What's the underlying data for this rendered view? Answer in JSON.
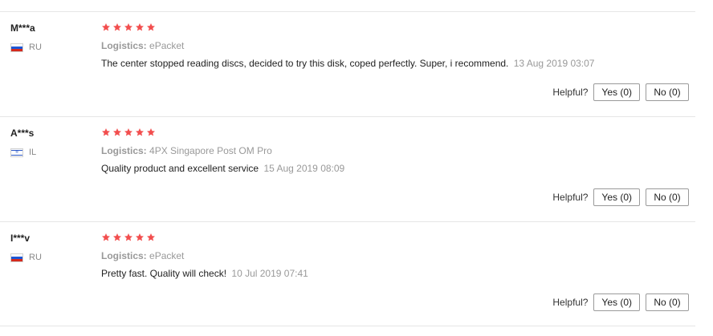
{
  "colors": {
    "star": "#f24e4e",
    "muted_text": "#999999",
    "separator": "#e6e6e6"
  },
  "helpful_label": "Helpful?",
  "reviews": [
    {
      "user": "M***a",
      "country": "RU",
      "flag_icon": "russia-flag-icon",
      "rating": 5,
      "logistics_label": "Logistics:",
      "logistics_value": "ePacket",
      "text": "The center stopped reading discs, decided to try this disk, coped perfectly. Super, i recommend.",
      "date": "13 Aug 2019 03:07",
      "yes_label": "Yes (0)",
      "no_label": "No (0)"
    },
    {
      "user": "A***s",
      "country": "IL",
      "flag_icon": "israel-flag-icon",
      "rating": 5,
      "logistics_label": "Logistics:",
      "logistics_value": "4PX Singapore Post OM Pro",
      "text": "Quality product and excellent service",
      "date": "15 Aug 2019 08:09",
      "yes_label": "Yes (0)",
      "no_label": "No (0)"
    },
    {
      "user": "I***v",
      "country": "RU",
      "flag_icon": "russia-flag-icon",
      "rating": 5,
      "logistics_label": "Logistics:",
      "logistics_value": "ePacket",
      "text": "Pretty fast. Quality will check!",
      "date": "10 Jul 2019 07:41",
      "yes_label": "Yes (0)",
      "no_label": "No (0)"
    }
  ]
}
